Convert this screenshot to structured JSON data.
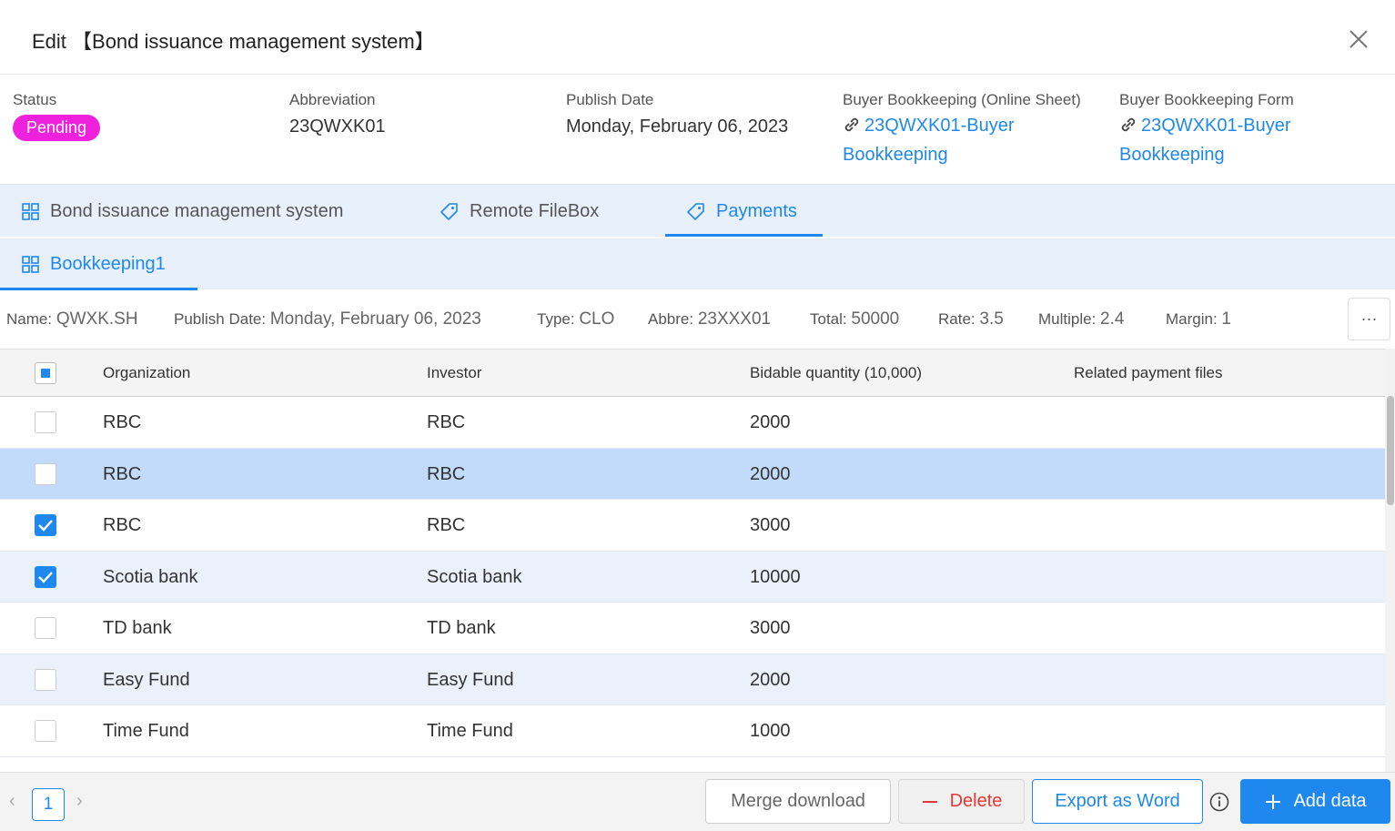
{
  "header": {
    "title": "Edit 【Bond issuance management system】"
  },
  "info": {
    "status_label": "Status",
    "status_value": "Pending",
    "abbr_label": "Abbreviation",
    "abbr_value": "23QWXK01",
    "publish_label": "Publish Date",
    "publish_value": "Monday, February 06, 2023",
    "online_label": "Buyer Bookkeeping (Online Sheet)",
    "online_link": "23QWXK01-Buyer Bookkeeping",
    "form_label": "Buyer Bookkeeping Form",
    "form_link": "23QWXK01-Buyer Bookkeeping"
  },
  "tabs": [
    {
      "label": "Bond issuance management system"
    },
    {
      "label": "Remote FileBox"
    },
    {
      "label": "Payments"
    }
  ],
  "subtab": {
    "label": "Bookkeeping1"
  },
  "meta": {
    "name_label": "Name:",
    "name_value": "QWXK.SH",
    "date_label": "Publish Date:",
    "date_value": "Monday, February 06, 2023",
    "type_label": "Type:",
    "type_value": "CLO",
    "abbre_label": "Abbre:",
    "abbre_value": "23XXX01",
    "total_label": "Total:",
    "total_value": "50000",
    "rate_label": "Rate:",
    "rate_value": "3.5",
    "multiple_label": "Multiple:",
    "multiple_value": "2.4",
    "margin_label": "Margin:",
    "margin_value": "1",
    "more_label": "···"
  },
  "table": {
    "columns": [
      "Organization",
      "Investor",
      "Bidable quantity (10,000)",
      "Related payment files"
    ],
    "rows": [
      {
        "org": "RBC",
        "investor": "RBC",
        "qty": "2000",
        "files": ""
      },
      {
        "org": "RBC",
        "investor": "RBC",
        "qty": "2000",
        "files": ""
      },
      {
        "org": "RBC",
        "investor": "RBC",
        "qty": "3000",
        "files": ""
      },
      {
        "org": "Scotia bank",
        "investor": "Scotia bank",
        "qty": "10000",
        "files": ""
      },
      {
        "org": "TD bank",
        "investor": "TD bank",
        "qty": "3000",
        "files": ""
      },
      {
        "org": "Easy Fund",
        "investor": "Easy Fund",
        "qty": "2000",
        "files": ""
      },
      {
        "org": "Time Fund",
        "investor": "Time Fund",
        "qty": "1000",
        "files": ""
      }
    ]
  },
  "footer": {
    "page": "1",
    "prev": "‹",
    "next": "›",
    "merge_label": "Merge download",
    "delete_label": "Delete",
    "export_label": "Export as Word",
    "add_label": "Add data"
  },
  "colors": {
    "accent": "#1e88ee",
    "pending": "#ee22dd",
    "danger": "#e53935"
  }
}
